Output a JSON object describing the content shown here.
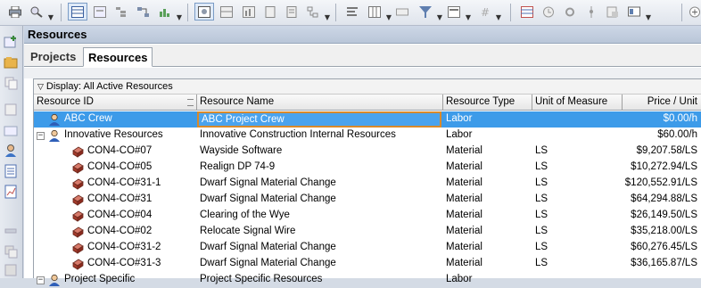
{
  "toolbar": {
    "buttons": [
      "printer-icon",
      "print-preview-icon",
      "layout-icon",
      "tracking-icon",
      "wbs-icon",
      "network-icon",
      "resource-view-icon",
      "columns-icon",
      "bars-icon",
      "filter-icon",
      "group-icon",
      "grid-icon",
      "table-icon",
      "clock-icon",
      "settings-icon",
      "pin-icon",
      "import-icon",
      "screen-icon",
      "add-icon"
    ]
  },
  "panel": {
    "title": "Resources"
  },
  "tabs": [
    {
      "label": "Projects",
      "selected": false
    },
    {
      "label": "Resources",
      "selected": true
    }
  ],
  "grid": {
    "group_label": "Display: All Active Resources",
    "columns": [
      {
        "label": "Resource ID"
      },
      {
        "label": "Resource Name"
      },
      {
        "label": "Resource Type"
      },
      {
        "label": "Unit of Measure"
      },
      {
        "label": "Price / Unit"
      }
    ],
    "rows": [
      {
        "id": "ABC Crew",
        "name": "ABC Project Crew",
        "type": "Labor",
        "uom": "",
        "price": "$0.00/h",
        "kind": "labor",
        "level": 0,
        "selected": true
      },
      {
        "id": "Innovative Resources",
        "name": "Innovative Construction Internal Resources",
        "type": "Labor",
        "uom": "",
        "price": "$60.00/h",
        "kind": "labor",
        "level": 0,
        "expander": "−"
      },
      {
        "id": "CON4-CO#07",
        "name": "Wayside Software",
        "type": "Material",
        "uom": "LS",
        "price": "$9,207.58/LS",
        "kind": "material",
        "level": 1
      },
      {
        "id": "CON4-CO#05",
        "name": "Realign DP 74-9",
        "type": "Material",
        "uom": "LS",
        "price": "$10,272.94/LS",
        "kind": "material",
        "level": 1
      },
      {
        "id": "CON4-CO#31-1",
        "name": "Dwarf Signal Material Change",
        "type": "Material",
        "uom": "LS",
        "price": "$120,552.91/LS",
        "kind": "material",
        "level": 1
      },
      {
        "id": "CON4-CO#31",
        "name": "Dwarf Signal Material Change",
        "type": "Material",
        "uom": "LS",
        "price": "$64,294.88/LS",
        "kind": "material",
        "level": 1
      },
      {
        "id": "CON4-CO#04",
        "name": "Clearing of the Wye",
        "type": "Material",
        "uom": "LS",
        "price": "$26,149.50/LS",
        "kind": "material",
        "level": 1
      },
      {
        "id": "CON4-CO#02",
        "name": "Relocate Signal Wire",
        "type": "Material",
        "uom": "LS",
        "price": "$35,218.00/LS",
        "kind": "material",
        "level": 1
      },
      {
        "id": "CON4-CO#31-2",
        "name": "Dwarf Signal Material Change",
        "type": "Material",
        "uom": "LS",
        "price": "$60,276.45/LS",
        "kind": "material",
        "level": 1
      },
      {
        "id": "CON4-CO#31-3",
        "name": "Dwarf Signal Material Change",
        "type": "Material",
        "uom": "LS",
        "price": "$36,165.87/LS",
        "kind": "material",
        "level": 1
      },
      {
        "id": "Project Specific",
        "name": "Project Specific Resources",
        "type": "Labor",
        "uom": "",
        "price": "",
        "kind": "labor",
        "level": 0,
        "expander": "−"
      }
    ]
  },
  "colors": {
    "selection": "#3d9be9",
    "edit_border": "#d98a2b"
  }
}
